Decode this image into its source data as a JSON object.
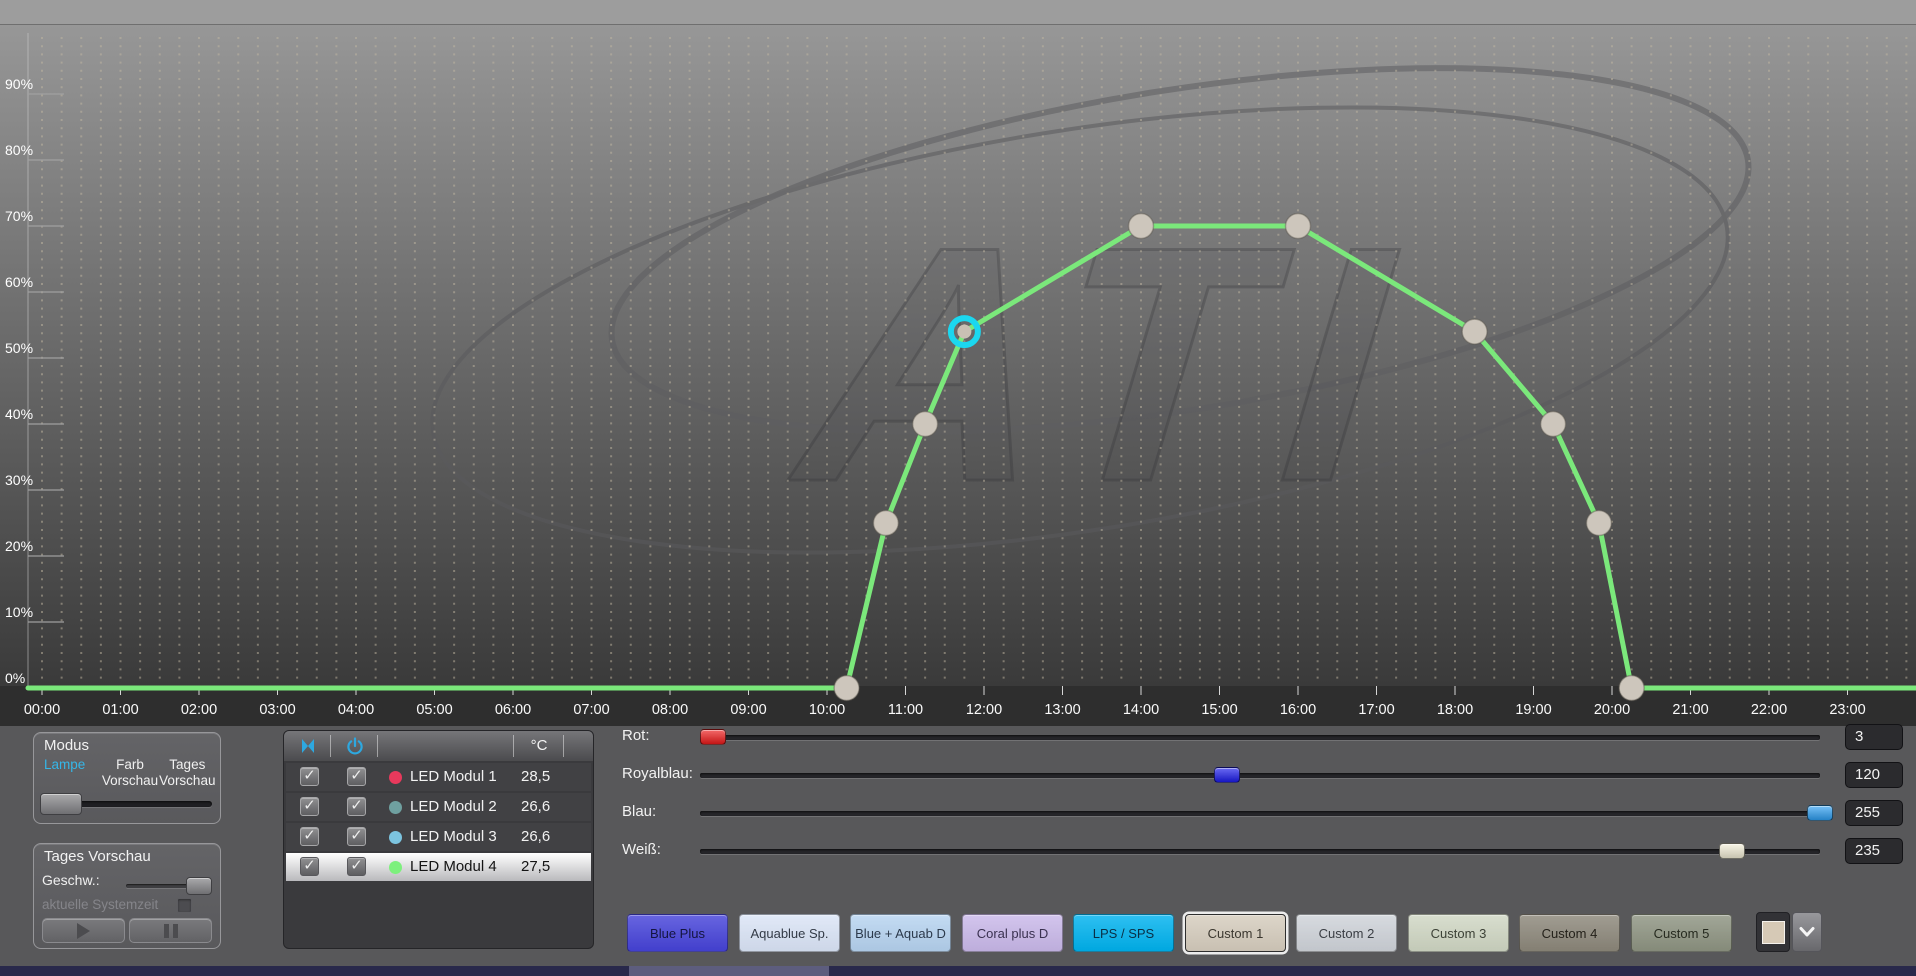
{
  "chart_data": {
    "type": "line",
    "title": "",
    "watermark": "ATI",
    "x_ticks": [
      "00:00",
      "01:00",
      "02:00",
      "03:00",
      "04:00",
      "05:00",
      "06:00",
      "07:00",
      "08:00",
      "09:00",
      "10:00",
      "11:00",
      "12:00",
      "13:00",
      "14:00",
      "15:00",
      "16:00",
      "17:00",
      "18:00",
      "19:00",
      "20:00",
      "21:00",
      "22:00",
      "23:00"
    ],
    "y_ticks": [
      "0%",
      "10%",
      "20%",
      "30%",
      "40%",
      "50%",
      "60%",
      "70%",
      "80%",
      "90%"
    ],
    "xlim_hours": [
      0,
      24
    ],
    "ylim": [
      0,
      100
    ],
    "grid": "vertical-dotted-15min",
    "legend_position": "none",
    "selected_point_index": 3,
    "selected_point_color": "#1bd7ef",
    "point_color": "#cdc6bc",
    "series": [
      {
        "name": "LED Modul 4",
        "color": "#7be87b",
        "baseline_value": 0,
        "points": [
          {
            "time": "10:15",
            "value": 0
          },
          {
            "time": "10:45",
            "value": 25
          },
          {
            "time": "11:15",
            "value": 40
          },
          {
            "time": "11:45",
            "value": 54
          },
          {
            "time": "14:00",
            "value": 70
          },
          {
            "time": "16:00",
            "value": 70
          },
          {
            "time": "18:15",
            "value": 54
          },
          {
            "time": "19:15",
            "value": 40
          },
          {
            "time": "19:50",
            "value": 25
          },
          {
            "time": "20:15",
            "value": 0
          }
        ]
      }
    ]
  },
  "modus_panel": {
    "title": "Modus",
    "options": [
      {
        "label": "Lampe",
        "active": true
      },
      {
        "label": "Farb Vorschau",
        "active": false
      },
      {
        "label": "Tages Vorschau",
        "active": false
      }
    ]
  },
  "tages_panel": {
    "title": "Tages Vorschau",
    "speed_label": "Geschw.:",
    "system_time_label": "aktuelle Systemzeit"
  },
  "module_list": {
    "temp_header": "°C",
    "icons": [
      "channels-link-icon",
      "power-icon"
    ],
    "rows": [
      {
        "name": "LED Modul 1",
        "temp": "28,5",
        "color": "#e8395c",
        "checked_1": true,
        "checked_2": true,
        "selected": false,
        "check_glyph": "✓"
      },
      {
        "name": "LED Modul 2",
        "temp": "26,6",
        "color": "#6fa0a0",
        "checked_1": true,
        "checked_2": true,
        "selected": false,
        "check_glyph": "✓"
      },
      {
        "name": "LED Modul 3",
        "temp": "26,6",
        "color": "#7cc4e0",
        "checked_1": true,
        "checked_2": true,
        "selected": false,
        "check_glyph": "✓"
      },
      {
        "name": "LED Modul 4",
        "temp": "27,5",
        "color": "#7df07d",
        "checked_1": true,
        "checked_2": true,
        "selected": true,
        "check_glyph": "✓"
      }
    ]
  },
  "channel_sliders": {
    "max": 255,
    "items": [
      {
        "key": "rot",
        "label": "Rot:",
        "value": 3,
        "color": "#ee1a1a"
      },
      {
        "key": "royalblau",
        "label": "Royalblau:",
        "value": 120,
        "color": "#1b1bec"
      },
      {
        "key": "blau",
        "label": "Blau:",
        "value": 255,
        "color": "#2e9ff2"
      },
      {
        "key": "weiss",
        "label": "Weiß:",
        "value": 235,
        "color": "#f4efd8"
      }
    ]
  },
  "presets": [
    {
      "label": "Blue Plus",
      "bg": "#4643d9",
      "text_color": "#14143f",
      "selected": false
    },
    {
      "label": "Aquablue Sp.",
      "bg": "#dae4f6",
      "text_color": "#333a46",
      "selected": false
    },
    {
      "label": "Blue + Aquab D",
      "bg": "#b6d3f0",
      "text_color": "#2c3a4c",
      "selected": false
    },
    {
      "label": "Coral plus D",
      "bg": "#c9b8e9",
      "text_color": "#3a3150",
      "selected": false
    },
    {
      "label": "LPS / SPS",
      "bg": "#00b2ee",
      "text_color": "#0a2f45",
      "selected": false
    },
    {
      "label": "Custom 1",
      "bg": "#d5ccbd",
      "text_color": "#3b372f",
      "selected": true
    },
    {
      "label": "Custom 2",
      "bg": "#ced2d8",
      "text_color": "#3a3e44",
      "selected": false
    },
    {
      "label": "Custom 3",
      "bg": "#cfd6c3",
      "text_color": "#3c4136",
      "selected": false
    },
    {
      "label": "Custom 4",
      "bg": "#8c877a",
      "text_color": "#24211a",
      "selected": false
    },
    {
      "label": "Custom 5",
      "bg": "#8d9381",
      "text_color": "#262a1f",
      "selected": false
    }
  ],
  "swatch": {
    "color": "#d6c9b6"
  }
}
